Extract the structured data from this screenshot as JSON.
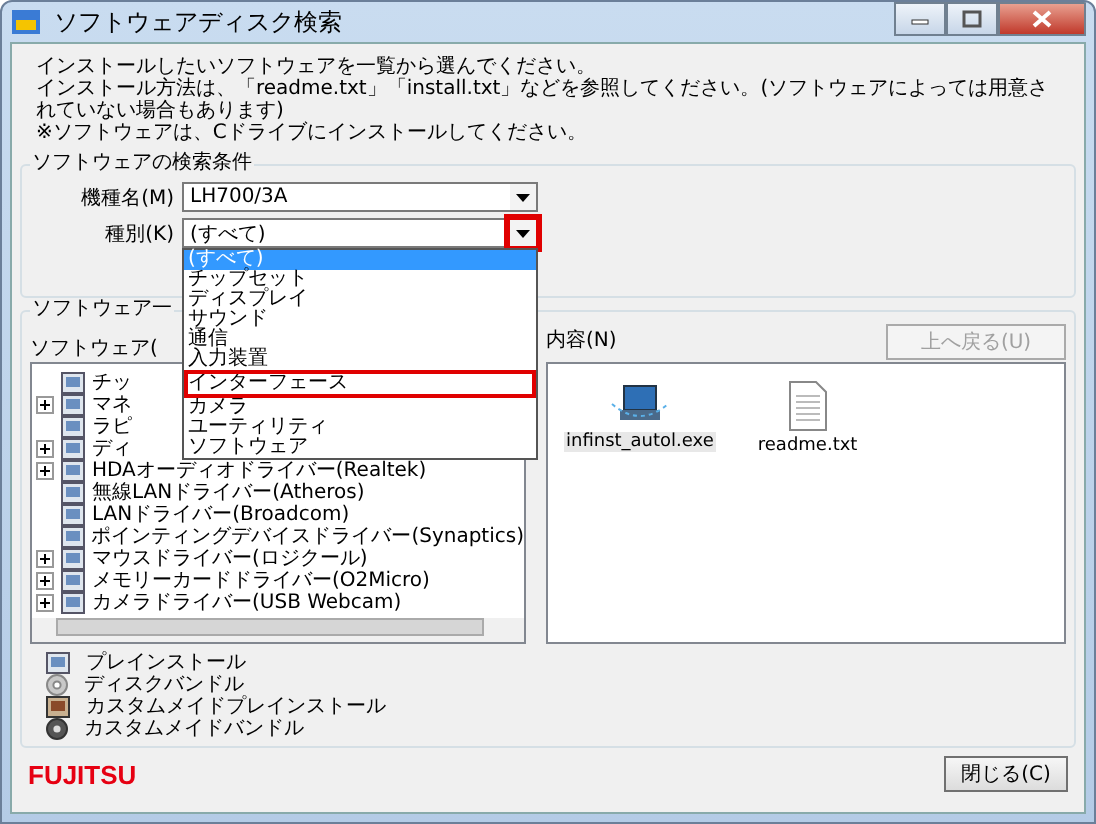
{
  "window": {
    "title": "ソフトウェアディスク検索"
  },
  "instructions": [
    "インストールしたいソフトウェアを一覧から選んでください。",
    "インストール方法は、「readme.txt」「install.txt」などを参照してください。(ソフトウェアによっては用意されていない場合もあります)",
    "※ソフトウェアは、Cドライブにインストールしてください。"
  ],
  "search_conditions": {
    "title": "ソフトウェアの検索条件",
    "model": {
      "label": "機種名(M)",
      "value": "LH700/3A"
    },
    "type": {
      "label": "種別(K)",
      "value": "(すべて)",
      "arrow_highlighted": true,
      "options": [
        {
          "label": "(すべて)",
          "selected": true,
          "highlighted": false
        },
        {
          "label": "チップセット",
          "selected": false,
          "highlighted": false
        },
        {
          "label": "ディスプレイ",
          "selected": false,
          "highlighted": false
        },
        {
          "label": "サウンド",
          "selected": false,
          "highlighted": false
        },
        {
          "label": "通信",
          "selected": false,
          "highlighted": false
        },
        {
          "label": "入力装置",
          "selected": false,
          "highlighted": false
        },
        {
          "label": "インターフェース",
          "selected": false,
          "highlighted": true
        },
        {
          "label": "カメラ",
          "selected": false,
          "highlighted": false
        },
        {
          "label": "ユーティリティ",
          "selected": false,
          "highlighted": false
        },
        {
          "label": "ソフトウェア",
          "selected": false,
          "highlighted": false
        }
      ]
    }
  },
  "software_list": {
    "title": "ソフトウェア一",
    "tree_label": "ソフトウェア(",
    "tree": [
      {
        "label": "チッ",
        "expandable": false
      },
      {
        "label": "マネ",
        "expandable": true
      },
      {
        "label": "ラピ",
        "expandable": false
      },
      {
        "label": "ディ",
        "expandable": true
      },
      {
        "label": "HDAオーディオドライバー(Realtek)",
        "expandable": true
      },
      {
        "label": "無線LANドライバー(Atheros)",
        "expandable": false
      },
      {
        "label": "LANドライバー(Broadcom)",
        "expandable": false
      },
      {
        "label": "ポインティングデバイスドライバー(Synaptics)",
        "expandable": false
      },
      {
        "label": "マウスドライバー(ロジクール)",
        "expandable": true
      },
      {
        "label": "メモリーカードドライバー(O2Micro)",
        "expandable": true
      },
      {
        "label": "カメラドライバー(USB Webcam)",
        "expandable": true
      }
    ],
    "contents_label": "内容(N)",
    "up_button": {
      "label": "上へ戻る(U)",
      "disabled": true
    },
    "files": [
      {
        "name": "infinst_autol.exe",
        "kind": "exe",
        "selected": true
      },
      {
        "name": "readme.txt",
        "kind": "txt",
        "selected": false
      }
    ]
  },
  "legend": [
    {
      "kind": "preinstall",
      "label": "プレインストール"
    },
    {
      "kind": "bundle",
      "label": "ディスクバンドル"
    },
    {
      "kind": "custom-preinstall",
      "label": "カスタムメイドプレインストール"
    },
    {
      "kind": "custom-bundle",
      "label": "カスタムメイドバンドル"
    }
  ],
  "logo": "FUJITSU",
  "close_button": "閉じる(C)"
}
